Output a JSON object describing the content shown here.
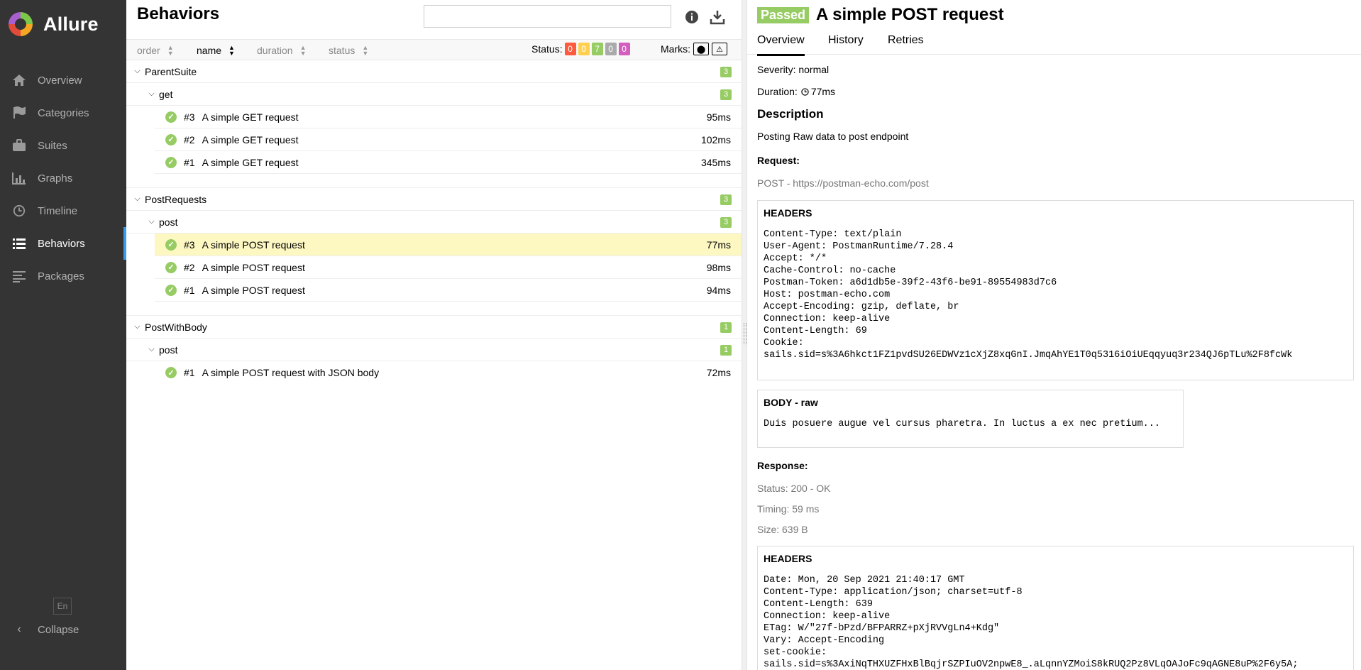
{
  "app": {
    "name": "Allure"
  },
  "sidebar": {
    "items": [
      {
        "label": "Overview",
        "icon": "home-icon"
      },
      {
        "label": "Categories",
        "icon": "flag-icon"
      },
      {
        "label": "Suites",
        "icon": "briefcase-icon"
      },
      {
        "label": "Graphs",
        "icon": "bar-chart-icon"
      },
      {
        "label": "Timeline",
        "icon": "clock-icon"
      },
      {
        "label": "Behaviors",
        "icon": "list-icon",
        "active": true
      },
      {
        "label": "Packages",
        "icon": "align-left-icon"
      }
    ],
    "language": "En",
    "collapse_label": "Collapse"
  },
  "behaviors": {
    "title": "Behaviors",
    "search": {
      "value": "",
      "placeholder": ""
    },
    "sort_columns": [
      "order",
      "name",
      "duration",
      "status"
    ],
    "status_label": "Status:",
    "status_counts": {
      "failed": "0",
      "broken": "0",
      "passed": "7",
      "skipped": "0",
      "unknown": "0"
    },
    "marks_label": "Marks:",
    "groups": [
      {
        "name": "ParentSuite",
        "count": "3",
        "sub": {
          "name": "get",
          "count": "3",
          "tests": [
            {
              "order": "#3",
              "name": "A simple GET request",
              "duration": "95ms"
            },
            {
              "order": "#2",
              "name": "A simple GET request",
              "duration": "102ms"
            },
            {
              "order": "#1",
              "name": "A simple GET request",
              "duration": "345ms"
            }
          ]
        }
      },
      {
        "name": "PostRequests",
        "count": "3",
        "sub": {
          "name": "post",
          "count": "3",
          "tests": [
            {
              "order": "#3",
              "name": "A simple POST request",
              "duration": "77ms",
              "selected": true
            },
            {
              "order": "#2",
              "name": "A simple POST request",
              "duration": "98ms"
            },
            {
              "order": "#1",
              "name": "A simple POST request",
              "duration": "94ms"
            }
          ]
        }
      },
      {
        "name": "PostWithBody",
        "count": "1",
        "sub": {
          "name": "post",
          "count": "1",
          "tests": [
            {
              "order": "#1",
              "name": "A simple POST request with JSON body",
              "duration": "72ms"
            }
          ]
        }
      }
    ]
  },
  "detail": {
    "status": "Passed",
    "title": "A simple POST request",
    "tabs": [
      "Overview",
      "History",
      "Retries"
    ],
    "severity": "Severity: normal",
    "duration_label": "Duration:",
    "duration_value": "77ms",
    "description_heading": "Description",
    "description": "Posting Raw data to post endpoint",
    "request_heading": "Request:",
    "request_line": "POST - https://postman-echo.com/post",
    "request_headers_caption": "HEADERS",
    "request_headers": "Content-Type: text/plain\nUser-Agent: PostmanRuntime/7.28.4\nAccept: */*\nCache-Control: no-cache\nPostman-Token: a6d1db5e-39f2-43f6-be91-89554983d7c6\nHost: postman-echo.com\nAccept-Encoding: gzip, deflate, br\nConnection: keep-alive\nContent-Length: 69\nCookie:\nsails.sid=s%3A6hkct1FZ1pvdSU26EDWVz1cXjZ8xqGnI.JmqAhYE1T0q5316iOiUEqqyuq3r234QJ6pTLu%2F8fcWk",
    "body_caption": "BODY - raw",
    "body": "Duis posuere augue vel cursus pharetra. In luctus a ex nec pretium...",
    "response_heading": "Response:",
    "response_status": "Status: 200 - OK",
    "response_timing": "Timing: 59 ms",
    "response_size": "Size: 639 B",
    "response_headers_caption": "HEADERS",
    "response_headers": "Date: Mon, 20 Sep 2021 21:40:17 GMT\nContent-Type: application/json; charset=utf-8\nContent-Length: 639\nConnection: keep-alive\nETag: W/\"27f-bPzd/BFPARRZ+pXjRVVgLn4+Kdg\"\nVary: Accept-Encoding\nset-cookie:\nsails.sid=s%3AxiNqTHXUZFHxBlBqjrSZPIuOV2npwE8_.aLqnnYZMoiS8kRUQ2Pz8VLqOAJoFc9qAGNE8uP%2F6y5A;"
  }
}
